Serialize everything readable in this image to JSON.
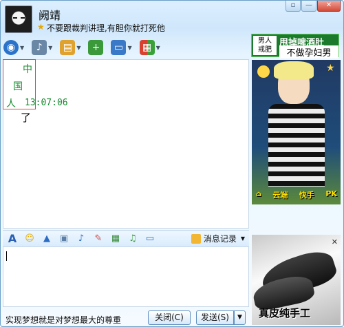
{
  "contact": {
    "nickname": "阙靖",
    "signature": "不要跟裁判讲理,有胆你就打死他",
    "signature_icon": "star-icon"
  },
  "window_controls": {
    "restore": "▫",
    "minimize": "—",
    "close": "✕"
  },
  "toolbar": {
    "items": [
      {
        "name": "video-call",
        "icon": "webcam-icon",
        "color": "#2a73c9"
      },
      {
        "name": "voice-call",
        "icon": "microphone-icon",
        "color": "#6a87a6"
      },
      {
        "name": "send-file",
        "icon": "folder-icon",
        "color": "#e0a22f"
      },
      {
        "name": "remote-assist",
        "icon": "add-screen-icon",
        "color": "#3a9a3a"
      },
      {
        "name": "share-screen",
        "icon": "monitor-icon",
        "color": "#3a78c8"
      },
      {
        "name": "apps",
        "icon": "apps-grid-icon",
        "color": "#d8412f"
      }
    ]
  },
  "ads": {
    "top": {
      "left_text": "男人\n戒肥",
      "line1": "甩掉啤酒肚",
      "line2": "不做孕妇男"
    },
    "middle": {
      "labels": [
        "云端",
        "快手",
        "PK"
      ]
    },
    "bottom": {
      "caption": "真皮纯手工",
      "close": "✕"
    }
  },
  "chat": {
    "message_chars": [
      "中",
      "国",
      "人"
    ],
    "time": "13:07:06",
    "continuation": "了"
  },
  "input_toolbar": {
    "history_label": "消息记录",
    "items": [
      "font-icon",
      "emoji-icon",
      "shake-icon",
      "gif-icon",
      "voice-message-icon",
      "doodle-icon",
      "image-icon",
      "music-icon",
      "screenshot-icon"
    ]
  },
  "footer": {
    "text": "实现梦想就是对梦想最大的尊重",
    "close_label": "关闭(C)",
    "send_label": "发送(S)",
    "send_dropdown": "▼"
  }
}
